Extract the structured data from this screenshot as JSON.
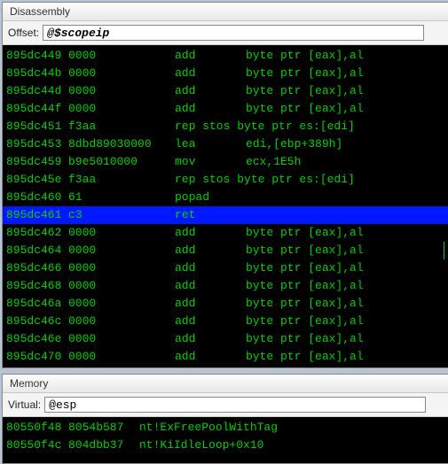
{
  "disasm": {
    "title": "Disassembly",
    "offset_label": "Offset:",
    "offset_value": "@$scopeip",
    "rows": [
      {
        "addr": "895dc449",
        "bytes": "0000",
        "mnem": "add",
        "ops": "byte ptr [eax],al",
        "sel": false
      },
      {
        "addr": "895dc44b",
        "bytes": "0000",
        "mnem": "add",
        "ops": "byte ptr [eax],al",
        "sel": false
      },
      {
        "addr": "895dc44d",
        "bytes": "0000",
        "mnem": "add",
        "ops": "byte ptr [eax],al",
        "sel": false
      },
      {
        "addr": "895dc44f",
        "bytes": "0000",
        "mnem": "add",
        "ops": "byte ptr [eax],al",
        "sel": false
      },
      {
        "addr": "895dc451",
        "bytes": "f3aa",
        "mnem": "rep stos byte ptr es:[edi]",
        "ops": "",
        "sel": false
      },
      {
        "addr": "895dc453",
        "bytes": "8dbd89030000",
        "mnem": "lea",
        "ops": "edi,[ebp+389h]",
        "sel": false
      },
      {
        "addr": "895dc459",
        "bytes": "b9e5010000",
        "mnem": "mov",
        "ops": "ecx,1E5h",
        "sel": false
      },
      {
        "addr": "895dc45e",
        "bytes": "f3aa",
        "mnem": "rep stos byte ptr es:[edi]",
        "ops": "",
        "sel": false
      },
      {
        "addr": "895dc460",
        "bytes": "61",
        "mnem": "popad",
        "ops": "",
        "sel": false
      },
      {
        "addr": "895dc461",
        "bytes": "c3",
        "mnem": "ret",
        "ops": "",
        "sel": true
      },
      {
        "addr": "895dc462",
        "bytes": "0000",
        "mnem": "add",
        "ops": "byte ptr [eax],al",
        "sel": false
      },
      {
        "addr": "895dc464",
        "bytes": "0000",
        "mnem": "add",
        "ops": "byte ptr [eax],al",
        "sel": false,
        "caret": true
      },
      {
        "addr": "895dc466",
        "bytes": "0000",
        "mnem": "add",
        "ops": "byte ptr [eax],al",
        "sel": false
      },
      {
        "addr": "895dc468",
        "bytes": "0000",
        "mnem": "add",
        "ops": "byte ptr [eax],al",
        "sel": false
      },
      {
        "addr": "895dc46a",
        "bytes": "0000",
        "mnem": "add",
        "ops": "byte ptr [eax],al",
        "sel": false
      },
      {
        "addr": "895dc46c",
        "bytes": "0000",
        "mnem": "add",
        "ops": "byte ptr [eax],al",
        "sel": false
      },
      {
        "addr": "895dc46e",
        "bytes": "0000",
        "mnem": "add",
        "ops": "byte ptr [eax],al",
        "sel": false
      },
      {
        "addr": "895dc470",
        "bytes": "0000",
        "mnem": "add",
        "ops": "byte ptr [eax],al",
        "sel": false
      }
    ]
  },
  "memory": {
    "title": "Memory",
    "virtual_label": "Virtual:",
    "virtual_value": "@esp",
    "rows": [
      {
        "addr": "80550f48",
        "val": "8054b587",
        "sym": "nt!ExFreePoolWithTag"
      },
      {
        "addr": "80550f4c",
        "val": "804dbb37",
        "sym": "nt!KiIdleLoop+0x10"
      }
    ]
  }
}
